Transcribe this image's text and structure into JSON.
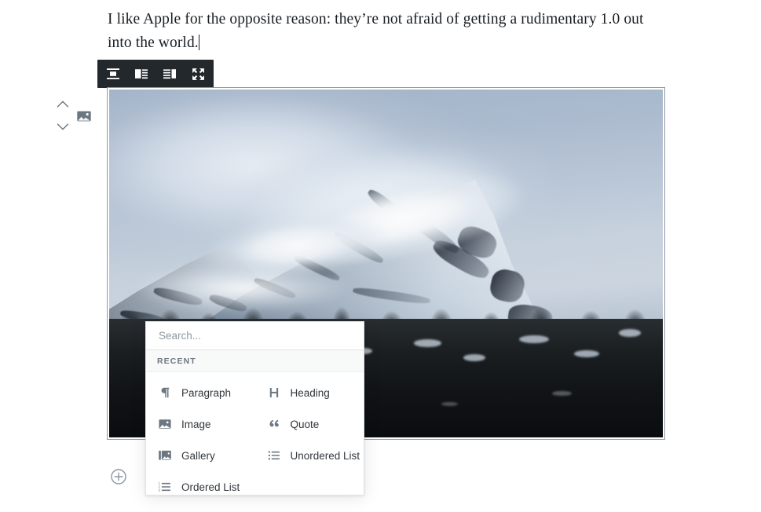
{
  "editor": {
    "paragraph_text": "I like Apple for the opposite reason: they’re not afraid of getting a rudimentary 1.0 out into the world.",
    "caret_visible": true
  },
  "block_controls": {
    "move_up_icon": "chevron-up-icon",
    "move_down_icon": "chevron-down-icon",
    "block_type_icon": "image-block-icon"
  },
  "toolbar": {
    "buttons": [
      {
        "name": "align-center",
        "label": "Align center",
        "icon": "align-center-icon"
      },
      {
        "name": "align-left",
        "label": "Align left",
        "icon": "align-left-icon"
      },
      {
        "name": "align-right",
        "label": "Align right",
        "icon": "align-right-icon"
      },
      {
        "name": "full-width",
        "label": "Full width",
        "icon": "fullscreen-expand-icon"
      }
    ],
    "background_color": "#23282d",
    "icon_color": "#ffffff"
  },
  "image_block": {
    "selected": true,
    "border_color": "#8d96a0",
    "alt": "Snow-covered mountain peak with cloud cap above a dark forested ridge"
  },
  "inserter": {
    "search": {
      "placeholder": "Search...",
      "value": ""
    },
    "section_label": "RECENT",
    "items": [
      {
        "label": "Paragraph",
        "icon": "paragraph-icon"
      },
      {
        "label": "Heading",
        "icon": "heading-icon"
      },
      {
        "label": "Image",
        "icon": "image-icon"
      },
      {
        "label": "Quote",
        "icon": "quote-icon"
      },
      {
        "label": "Gallery",
        "icon": "gallery-icon"
      },
      {
        "label": "Unordered List",
        "icon": "unordered-list-icon"
      },
      {
        "label": "Ordered List",
        "icon": "ordered-list-icon"
      }
    ]
  },
  "add_block": {
    "icon": "plus-circle-icon",
    "label": "Add block"
  },
  "colors": {
    "text": "#191e23",
    "muted": "#6c7781",
    "panel_border": "#e2e4e7",
    "toolbar_bg": "#23282d"
  }
}
